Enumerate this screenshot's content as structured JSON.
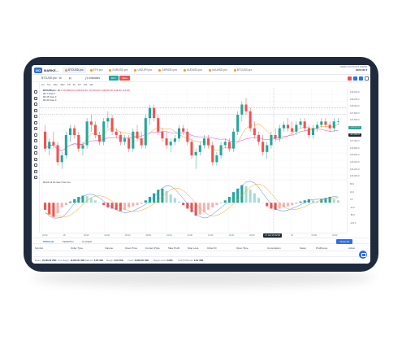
{
  "brand": {
    "mark": "GO",
    "text": "MARKE..."
  },
  "tabs": [
    {
      "label": "BTCUSD.pro",
      "active": true
    },
    {
      "label": "ETH.pro",
      "active": false
    },
    {
      "label": "EURUSD.pro",
      "active": false
    },
    {
      "label": "USDJPY.pro",
      "active": false
    },
    {
      "label": "GBPUSD.pro",
      "active": false
    },
    {
      "label": "AUDUSD.pro",
      "active": false
    },
    {
      "label": "XAUUSD.pro",
      "active": false
    },
    {
      "label": "BTCUSD.pro",
      "active": false
    }
  ],
  "account": {
    "line1": "DEMO ACCOUNT 100000",
    "balance": "$100,000 ▾"
  },
  "toolbar": {
    "symbol": "BTCUSD.pro · 1h",
    "indicators": "Indicators",
    "buy": "BUY",
    "sell": "SELL"
  },
  "timeframes": [
    "1m",
    "5m",
    "15m",
    "30m",
    "1h",
    "4h",
    "1D",
    "1W",
    "1M"
  ],
  "legend": {
    "symbol": "BTCUSD.pro · 1h",
    "ohlc": "O 107,882.00  H 108,012.00  L 107,901.00  C 108,001.00  +119.00 (+0.11%)",
    "ma1": "MA 7 close 0",
    "ma2": "MA 25 close 0",
    "ma3": "MA 99 close 0"
  },
  "macd_legend": "MACD 12 26 close 9 Vex Vex",
  "price_axis": [
    "108,400.0",
    "108,200.0",
    "108,000.0",
    "107,800.0",
    "107,600.0",
    "107,400.0",
    "107,200.0",
    "107,000.0",
    "106,800.0",
    "106,600.0",
    "106,400.0",
    "106,200.0",
    "106,000.0"
  ],
  "price_tags": {
    "current": "108,001.0",
    "cross": "107,812.0"
  },
  "macd_axis": [
    "80.0",
    "40.0",
    "0.0",
    "-40.0",
    "-80.0",
    "-120.0"
  ],
  "time_axis": [
    "22:00",
    "18",
    "02:00",
    "04:00",
    "06:00",
    "08:00",
    "10:00",
    "12:00",
    "14:00",
    "16:00",
    "20:00",
    "22:00",
    "19",
    "02:00",
    "04:00"
  ],
  "crosshair_time": "17 Jun '25  12:00",
  "bottom_tabs": [
    "OPEN (3)",
    "PENDING",
    "CLOSED"
  ],
  "close_all": "Close All",
  "table_headers": [
    "Symbol",
    "Order Type",
    "Volume",
    "Open Price",
    "Current Price",
    "Take Profit",
    "Stop Loss",
    "Order ID",
    "Open Time",
    "Commission",
    "Swap",
    "Profit/Loss",
    "Action"
  ],
  "footer": [
    {
      "label": "Equity:",
      "value": "10,000.00 USD"
    },
    {
      "label": "Free Margin:",
      "value": "10,000.00 USD"
    },
    {
      "label": "Balance:",
      "value": "0.00 USD"
    },
    {
      "label": "Margin:",
      "value": "0.00 USD"
    },
    {
      "label": "Credit:",
      "value": "10,000.00 USD"
    },
    {
      "label": "Margin Level:",
      "value": "0.00%"
    },
    {
      "label": "Total Profit/Loss:",
      "value": "0.00 USD"
    }
  ],
  "colors": {
    "up": "#26a69a",
    "down": "#ef5350",
    "accent": "#2f6fe4",
    "frame": "#1f2a3c",
    "ma_pink": "#d946ef",
    "ma_orange": "#f59e0b",
    "macd_blue": "#3b82f6"
  },
  "chart_data": {
    "type": "candlestick",
    "candles": [
      [
        107300,
        107500,
        106700,
        106800
      ],
      [
        106800,
        107100,
        106600,
        107000
      ],
      [
        107000,
        107300,
        106800,
        106900
      ],
      [
        106900,
        107000,
        106300,
        106400
      ],
      [
        106400,
        106700,
        106200,
        106600
      ],
      [
        106600,
        107300,
        106500,
        107200
      ],
      [
        107200,
        107500,
        107000,
        107400
      ],
      [
        107400,
        107500,
        107100,
        107200
      ],
      [
        107200,
        107300,
        106700,
        106800
      ],
      [
        106800,
        107000,
        106600,
        106900
      ],
      [
        106900,
        107700,
        106800,
        107600
      ],
      [
        107600,
        107800,
        107300,
        107500
      ],
      [
        107500,
        107600,
        107100,
        107200
      ],
      [
        107200,
        107300,
        106900,
        107000
      ],
      [
        107000,
        107700,
        106900,
        107600
      ],
      [
        107600,
        107900,
        107400,
        107700
      ],
      [
        107700,
        107800,
        107200,
        107300
      ],
      [
        107300,
        107400,
        107100,
        107200
      ],
      [
        107200,
        107300,
        106900,
        107000
      ],
      [
        107000,
        107200,
        106900,
        107100
      ],
      [
        107100,
        107200,
        106700,
        106800
      ],
      [
        106800,
        107400,
        106700,
        107300
      ],
      [
        107300,
        107500,
        107000,
        107100
      ],
      [
        107100,
        107300,
        106800,
        106900
      ],
      [
        106900,
        107800,
        106800,
        107700
      ],
      [
        107700,
        108100,
        107500,
        108000
      ],
      [
        108000,
        108100,
        107600,
        107700
      ],
      [
        107700,
        107800,
        107200,
        107300
      ],
      [
        107300,
        107400,
        107000,
        107100
      ],
      [
        107100,
        107300,
        106800,
        106900
      ],
      [
        106900,
        107100,
        106700,
        107000
      ],
      [
        107000,
        107200,
        106900,
        107100
      ],
      [
        107100,
        107500,
        107000,
        107400
      ],
      [
        107400,
        107500,
        107200,
        107300
      ],
      [
        107300,
        107400,
        106900,
        107000
      ],
      [
        107000,
        107100,
        106500,
        106600
      ],
      [
        106600,
        106800,
        106200,
        106700
      ],
      [
        106700,
        107000,
        106600,
        106900
      ],
      [
        106900,
        107200,
        106800,
        107100
      ],
      [
        107100,
        107200,
        106800,
        106900
      ],
      [
        106900,
        107000,
        106300,
        106400
      ],
      [
        106400,
        106700,
        106300,
        106600
      ],
      [
        106600,
        107000,
        106500,
        106900
      ],
      [
        106900,
        107100,
        106800,
        107000
      ],
      [
        107000,
        107100,
        106700,
        106800
      ],
      [
        106800,
        107400,
        106700,
        107300
      ],
      [
        107300,
        107900,
        107200,
        107800
      ],
      [
        107800,
        108200,
        107600,
        108100
      ],
      [
        108100,
        108300,
        107800,
        107900
      ],
      [
        107900,
        108000,
        107300,
        107400
      ],
      [
        107400,
        107600,
        107100,
        107200
      ],
      [
        107200,
        107300,
        106900,
        107000
      ],
      [
        107000,
        107200,
        106600,
        106700
      ],
      [
        106700,
        107000,
        106500,
        106900
      ],
      [
        106900,
        107300,
        106800,
        107200
      ],
      [
        107200,
        107400,
        107000,
        107100
      ],
      [
        107100,
        107500,
        107000,
        107400
      ],
      [
        107400,
        107600,
        107300,
        107500
      ],
      [
        107500,
        107700,
        107300,
        107400
      ],
      [
        107400,
        107600,
        107200,
        107300
      ],
      [
        107300,
        107600,
        107200,
        107500
      ],
      [
        107500,
        107700,
        107400,
        107600
      ],
      [
        107600,
        107700,
        107300,
        107400
      ],
      [
        107400,
        107500,
        107100,
        107200
      ],
      [
        107200,
        107500,
        107100,
        107400
      ],
      [
        107400,
        107600,
        107300,
        107500
      ],
      [
        107500,
        107700,
        107400,
        107600
      ],
      [
        107600,
        107700,
        107400,
        107500
      ],
      [
        107500,
        107600,
        107300,
        107400
      ],
      [
        107400,
        107700,
        107300,
        107600
      ],
      [
        107600,
        107700,
        107500,
        107600
      ]
    ],
    "macd_hist": [
      -30,
      -50,
      -60,
      -45,
      -20,
      -10,
      5,
      15,
      25,
      30,
      28,
      20,
      10,
      0,
      -10,
      -20,
      -25,
      -30,
      -35,
      -30,
      -20,
      -15,
      -10,
      -5,
      10,
      25,
      40,
      55,
      60,
      50,
      35,
      20,
      5,
      -10,
      -25,
      -40,
      -55,
      -50,
      -40,
      -30,
      -20,
      -10,
      0,
      10,
      25,
      45,
      60,
      75,
      70,
      55,
      40,
      20,
      0,
      -15,
      -25,
      -30,
      -25,
      -20,
      -15,
      -10,
      -5,
      5,
      10,
      15,
      10,
      5,
      15,
      20,
      25,
      15,
      10
    ],
    "ylim": [
      106000,
      108400
    ],
    "macd_ylim": [
      -120,
      80
    ]
  }
}
